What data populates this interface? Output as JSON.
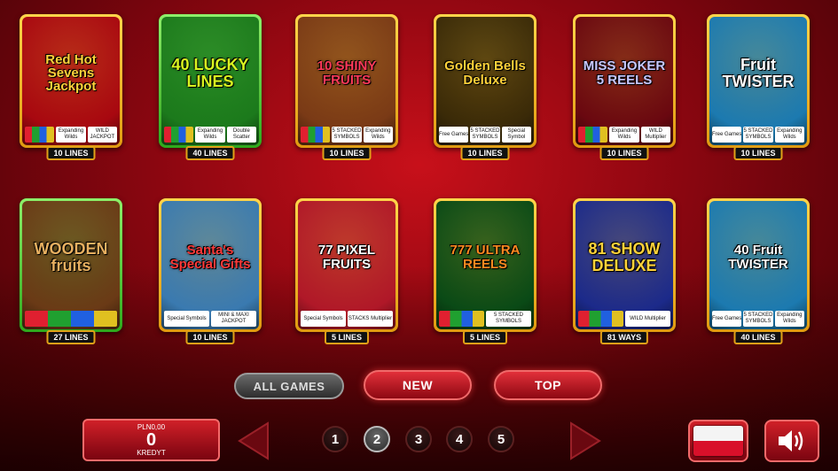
{
  "games": [
    {
      "title": "Red Hot Sevens Jackpot",
      "tag": "10 LINES",
      "feats": [
        "",
        "Expanding Wilds",
        "WILD JACKPOT"
      ],
      "bg": "#a80810",
      "title_color": "#ffd23a"
    },
    {
      "title": "40 LUCKY LINES",
      "tag": "40 LINES",
      "feats": [
        "",
        "Expanding Wilds",
        "Double Scatter"
      ],
      "bg": "#1c7a1c",
      "title_color": "#d8f520"
    },
    {
      "title": "10 SHINY FRUITS",
      "tag": "10 LINES",
      "feats": [
        "",
        "5 STACKED SYMBOLS",
        "Expanding Wilds"
      ],
      "bg": "#7a3a16",
      "title_color": "#ff3a5a"
    },
    {
      "title": "Golden Bells Deluxe",
      "tag": "10 LINES",
      "feats": [
        "Free Games",
        "5 STACKED SYMBOLS",
        "Special Symbol"
      ],
      "bg": "#3a2a08",
      "title_color": "#ffd23a"
    },
    {
      "title": "MISS JOKER 5 REELS",
      "tag": "10 LINES",
      "feats": [
        "",
        "Expanding Wilds",
        "WILD Multiplier"
      ],
      "bg": "#6a0810",
      "title_color": "#c8c8ff"
    },
    {
      "title": "Fruit TWISTER",
      "tag": "10 LINES",
      "feats": [
        "Free Games",
        "5 STACKED SYMBOLS",
        "Expanding Wilds"
      ],
      "bg": "#1c7ab0",
      "title_color": "#ffffff"
    },
    {
      "title": "WOODEN fruits",
      "tag": "27 LINES",
      "feats": [
        ""
      ],
      "bg": "#6a3a16",
      "title_color": "#e8b060"
    },
    {
      "title": "Santa's Special Gifts",
      "tag": "10 LINES",
      "feats": [
        "Special Symbols",
        "MINI & MAXI JACKPOT"
      ],
      "bg": "#3a7ab0",
      "title_color": "#ff3a3a"
    },
    {
      "title": "77 PIXEL FRUITS",
      "tag": "5 LINES",
      "feats": [
        "Special Symbols",
        "STACKS Multiplier"
      ],
      "bg": "#b01828",
      "title_color": "#ffffff"
    },
    {
      "title": "777 ULTRA REELS",
      "tag": "5 LINES",
      "feats": [
        "",
        "5 STACKED SYMBOLS"
      ],
      "bg": "#0a4a16",
      "title_color": "#ff8a20"
    },
    {
      "title": "81 SHOW DELUXE",
      "tag": "81 WAYS",
      "feats": [
        "",
        "WILD Multiplier"
      ],
      "bg": "#1c2a8a",
      "title_color": "#ffd23a"
    },
    {
      "title": "40 Fruit TWISTER",
      "tag": "40 LINES",
      "feats": [
        "Free Games",
        "5 STACKED SYMBOLS",
        "Expanding Wilds"
      ],
      "bg": "#1c7ab0",
      "title_color": "#ffffff"
    }
  ],
  "filters": {
    "all_games": "ALL GAMES",
    "new": "NEW",
    "top": "TOP"
  },
  "credit": {
    "currency": "PLN0,00",
    "value": "0",
    "label": "KREDYT"
  },
  "pages": [
    "1",
    "2",
    "3",
    "4",
    "5"
  ],
  "active_page": "2",
  "colors": {
    "accent_red": "#d02028",
    "gold": "#e0a018"
  }
}
